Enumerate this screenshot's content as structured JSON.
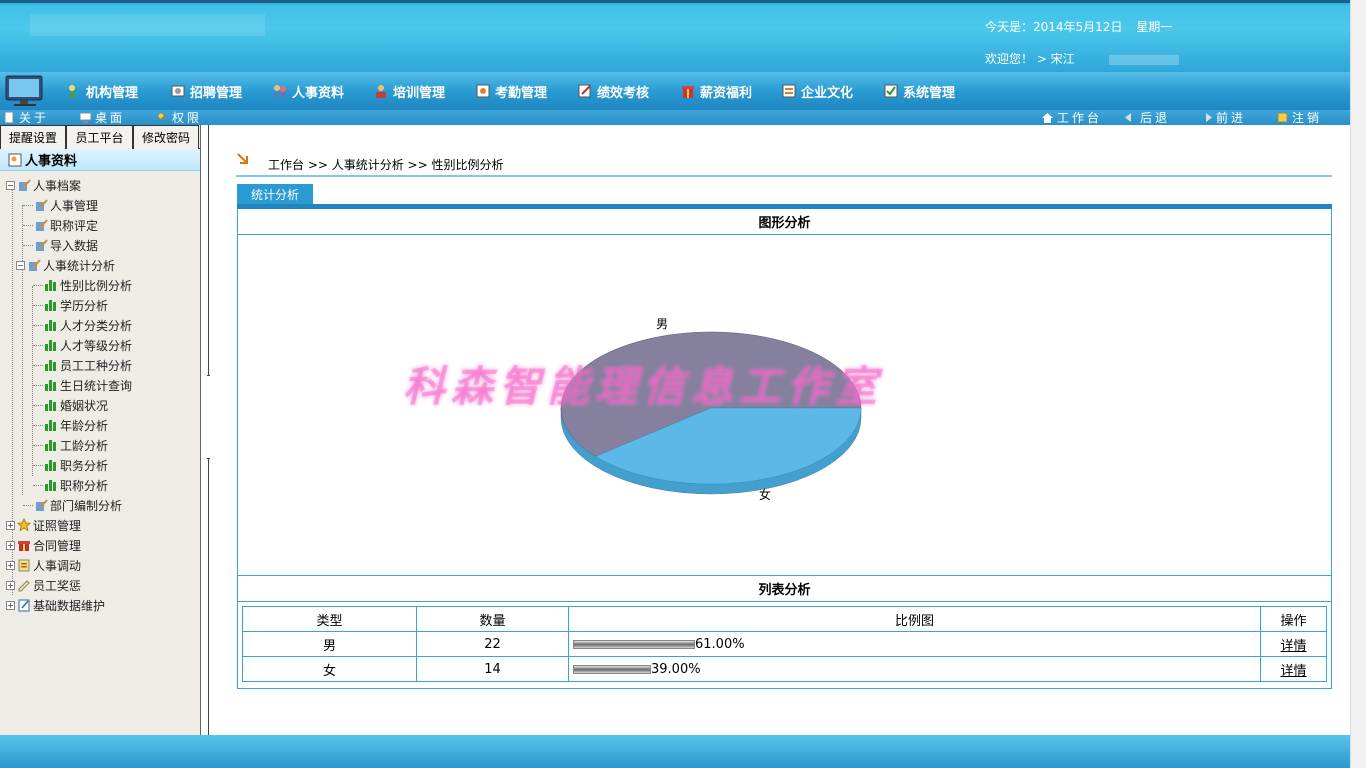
{
  "header": {
    "date_label": "今天是：2014年5月12日",
    "weekday": "星期一",
    "welcome": "欢迎您！ > 宋江"
  },
  "nav": {
    "items": [
      {
        "label": "机构管理",
        "icon": "org-icon"
      },
      {
        "label": "招聘管理",
        "icon": "recruit-icon"
      },
      {
        "label": "人事资料",
        "icon": "personnel-icon"
      },
      {
        "label": "培训管理",
        "icon": "training-icon"
      },
      {
        "label": "考勤管理",
        "icon": "attendance-icon"
      },
      {
        "label": "绩效考核",
        "icon": "performance-icon"
      },
      {
        "label": "薪资福利",
        "icon": "salary-icon"
      },
      {
        "label": "企业文化",
        "icon": "culture-icon"
      },
      {
        "label": "系统管理",
        "icon": "system-icon"
      }
    ]
  },
  "subbar": {
    "about": "关于",
    "desktop": "桌面",
    "permission": "权限",
    "workbench": "工作台",
    "back": "后退",
    "forward": "前进",
    "logout": "注销"
  },
  "sidebar": {
    "tabs": [
      "提醒设置",
      "员工平台",
      "修改密码"
    ],
    "title": "人事资料",
    "tree": {
      "root": "人事档案",
      "children": [
        "人事管理",
        "职称评定",
        "导入数据"
      ],
      "stats": "人事统计分析",
      "stats_children": [
        "性别比例分析",
        "学历分析",
        "人才分类分析",
        "人才等级分析",
        "员工工种分析",
        "生日统计查询",
        "婚姻状况",
        "年龄分析",
        "工龄分析",
        "职务分析",
        "职称分析"
      ],
      "dept": "部门编制分析",
      "others": [
        "证照管理",
        "合同管理",
        "人事调动",
        "员工奖惩",
        "基础数据维护"
      ]
    }
  },
  "main": {
    "breadcrumb": "工作台 >> 人事统计分析 >> 性别比例分析",
    "tab": "统计分析",
    "chart_title": "图形分析",
    "watermark": "科森智能理信息工作室",
    "list_title": "列表分析",
    "table": {
      "headers": [
        "类型",
        "数量",
        "比例图",
        "操作"
      ],
      "rows": [
        {
          "type": "男",
          "count": "22",
          "pct": "61.00%",
          "fraction": 0.61,
          "action": "详情"
        },
        {
          "type": "女",
          "count": "14",
          "pct": "39.00%",
          "fraction": 0.39,
          "action": "详情"
        }
      ]
    }
  },
  "chart_data": {
    "type": "pie",
    "categories": [
      "男",
      "女"
    ],
    "values": [
      61,
      39
    ],
    "colors": [
      "#84809e",
      "#5cb8e6"
    ],
    "title": ""
  }
}
